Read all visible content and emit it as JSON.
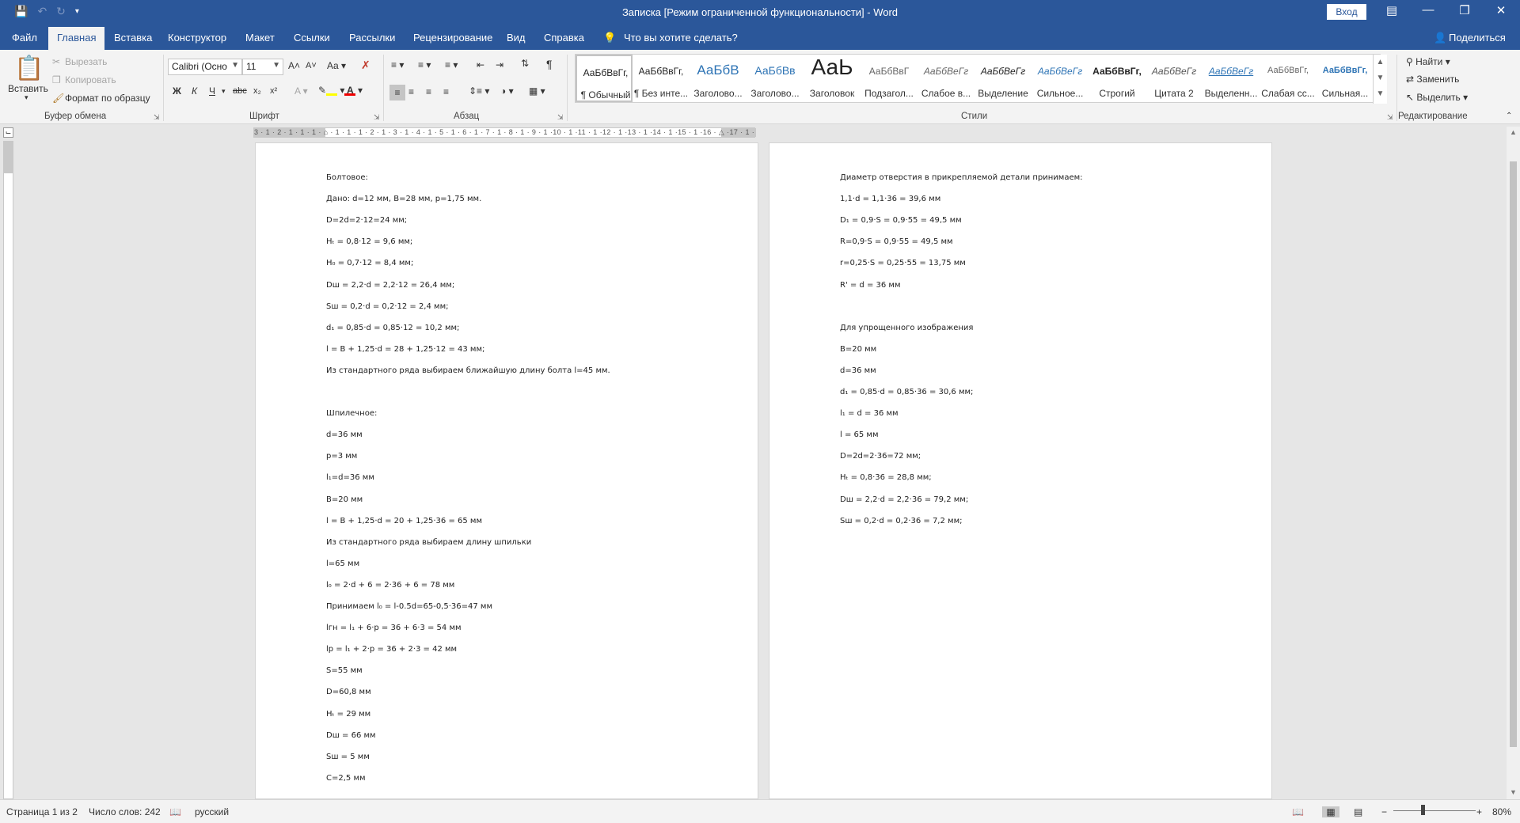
{
  "title_bar": {
    "title": "Записка [Режим ограниченной функциональности]  -  Word",
    "login": "Вход",
    "save_icon": "save-icon",
    "undo_icon": "undo-icon",
    "redo_icon": "redo-icon"
  },
  "tabs": {
    "items": [
      "Файл",
      "Главная",
      "Вставка",
      "Конструктор",
      "Макет",
      "Ссылки",
      "Рассылки",
      "Рецензирование",
      "Вид",
      "Справка"
    ],
    "search": "Что вы хотите сделать?",
    "share": "Поделиться",
    "active": "Главная"
  },
  "ribbon": {
    "clipboard": {
      "paste": "Вставить",
      "cut": "Вырезать",
      "copy": "Копировать",
      "format_painter": "Формат по образцу",
      "label": "Буфер обмена"
    },
    "font": {
      "family": "Calibri (Осно",
      "size": "11",
      "label": "Шрифт",
      "case": "Aa"
    },
    "paragraph": {
      "label": "Абзац"
    },
    "styles": {
      "label": "Стили",
      "items": [
        {
          "sample": "АаБбВвГг,",
          "name": "¶ Обычный"
        },
        {
          "sample": "АаБбВвГг,",
          "name": "¶ Без инте..."
        },
        {
          "sample": "АаБбВ",
          "name": "Заголово..."
        },
        {
          "sample": "АаБбВв",
          "name": "Заголово..."
        },
        {
          "sample": "АаЬ",
          "name": "Заголовок"
        },
        {
          "sample": "АаБбВвГ",
          "name": "Подзагол..."
        },
        {
          "sample": "АаБбВеГг",
          "name": "Слабое в..."
        },
        {
          "sample": "АаБбВеГг",
          "name": "Выделение"
        },
        {
          "sample": "АаБбВеГг",
          "name": "Сильное..."
        },
        {
          "sample": "АаБбВвГг,",
          "name": "Строгий"
        },
        {
          "sample": "АаБбВеГг",
          "name": "Цитата 2"
        },
        {
          "sample": "АаБбВеГг",
          "name": "Выделенн..."
        },
        {
          "sample": "АаБбВвГг,",
          "name": "Слабая сс..."
        },
        {
          "sample": "АаБбВвГг,",
          "name": "Сильная..."
        }
      ]
    },
    "editing": {
      "label": "Редактирование",
      "find": "Найти",
      "replace": "Заменить",
      "select": "Выделить"
    }
  },
  "ruler": {
    "numbers": "3 · 1 · 2 · 1 · 1 · 1 · ⌂ · 1 · 1 · 1 · 2 · 1 · 3 · 1 · 4 · 1 · 5 · 1 · 6 · 1 · 7 · 1 · 8 · 1 · 9 · 1 ·10 · 1 ·11 · 1 ·12 · 1 ·13 · 1 ·14 · 1 ·15 · 1 ·16 · △ ·17 · 1 ·"
  },
  "pages": {
    "left": [
      "Болтовое:",
      "Дано: d=12 мм, B=28 мм, p=1,75 мм.",
      "D=2d=2·12=24 мм;",
      "Hₜ = 0,8·12 = 9,6 мм;",
      "H₀ = 0,7·12 = 8,4 мм;",
      "Dш = 2,2·d = 2,2·12 = 26,4 мм;",
      "Sш = 0,2·d = 0,2·12 = 2,4 мм;",
      "d₁ = 0,85·d = 0,85·12 = 10,2 мм;",
      "l = B + 1,25·d = 28 + 1,25·12 = 43 мм;",
      "Из стандартного ряда выбираем ближайшую длину болта l=45 мм.",
      "",
      "Шпилечное:",
      "d=36 мм",
      "p=3 мм",
      "l₁=d=36 мм",
      "B=20 мм",
      "l = B + 1,25·d = 20 + 1,25·36 = 65 мм",
      "Из стандартного ряда выбираем длину шпильки",
      "l=65 мм",
      "l₀ = 2·d + 6 = 2·36 + 6 = 78 мм",
      "Принимаем l₀ = l-0.5d=65-0,5·36=47 мм",
      "lгн = l₁ + 6·p = 36 + 6·3 = 54 мм",
      "lр = l₁ + 2·p = 36 + 2·3 = 42 мм",
      "S=55 мм",
      "D=60,8 мм",
      "Hₜ = 29 мм",
      "Dш = 66 мм",
      "Sш = 5 мм",
      "C=2,5 мм"
    ],
    "right": [
      "Диаметр отверстия в прикрепляемой детали принимаем:",
      "1,1·d = 1,1·36 = 39,6 мм",
      "D₁ = 0,9·S = 0,9·55 = 49,5 мм",
      "R=0,9·S = 0,9·55 = 49,5 мм",
      "r=0,25·S = 0,25·55 = 13,75 мм",
      "R' = d = 36 мм",
      "",
      "Для упрощенного изображения",
      "B=20 мм",
      "d=36 мм",
      "d₁ = 0,85·d = 0,85·36 = 30,6 мм;",
      "l₁ = d = 36 мм",
      "l = 65 мм",
      "D=2d=2·36=72 мм;",
      "Hₜ = 0,8·36 = 28,8 мм;",
      "Dш = 2,2·d = 2,2·36 = 79,2 мм;",
      "Sш = 0,2·d = 0,2·36 = 7,2 мм;"
    ]
  },
  "status_bar": {
    "page": "Страница 1 из 2",
    "words": "Число слов: 242",
    "language": "русский",
    "zoom": "80%"
  }
}
